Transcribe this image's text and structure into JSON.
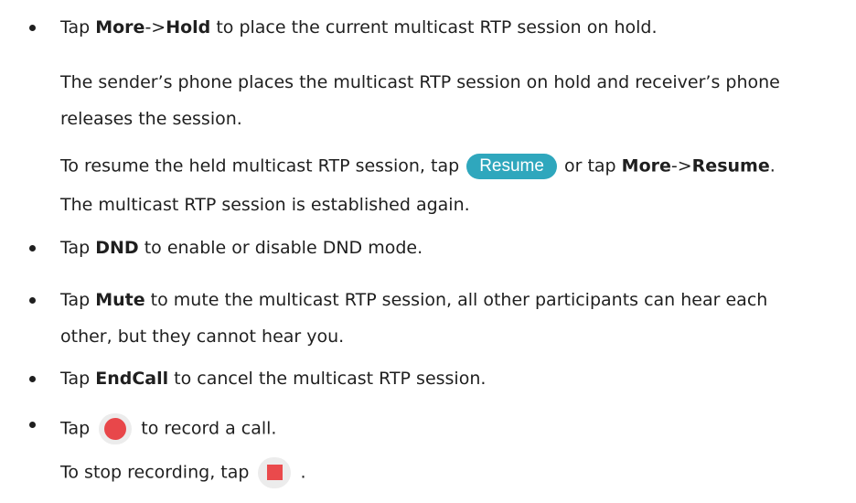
{
  "items": [
    {
      "text": [
        "Tap ",
        "More",
        "->",
        "Hold",
        " to place the current multicast RTP session on hold."
      ],
      "sub": {
        "p1": "The sender’s phone places the multicast RTP session on hold and receiver’s phone",
        "p1b": "releases the session.",
        "p2_pre": "To resume the held multicast RTP session, tap ",
        "resume_button": "Resume",
        "p2_mid": " or tap ",
        "more": "More",
        "arrow": "->",
        "resume": "Resume",
        "p2_end": ".",
        "p3": "The multicast RTP session is established again."
      }
    },
    {
      "pre": "Tap ",
      "bold": "DND",
      "post": " to enable or disable DND mode."
    },
    {
      "pre": "Tap ",
      "bold": "Mute",
      "post": " to mute the multicast RTP session, all other participants can hear each",
      "post2": "other, but they cannot hear you."
    },
    {
      "pre": "Tap ",
      "bold": "EndCall",
      "post": " to cancel the multicast RTP session."
    },
    {
      "pre": "Tap ",
      "post": " to record a call.",
      "sub": {
        "pre": "To stop recording, tap ",
        "post": " ."
      }
    }
  ],
  "icons": {
    "record": "record-icon",
    "stop": "stop-record-icon",
    "record_color": "#e8474a",
    "resume_color": "#2fa7bd"
  }
}
